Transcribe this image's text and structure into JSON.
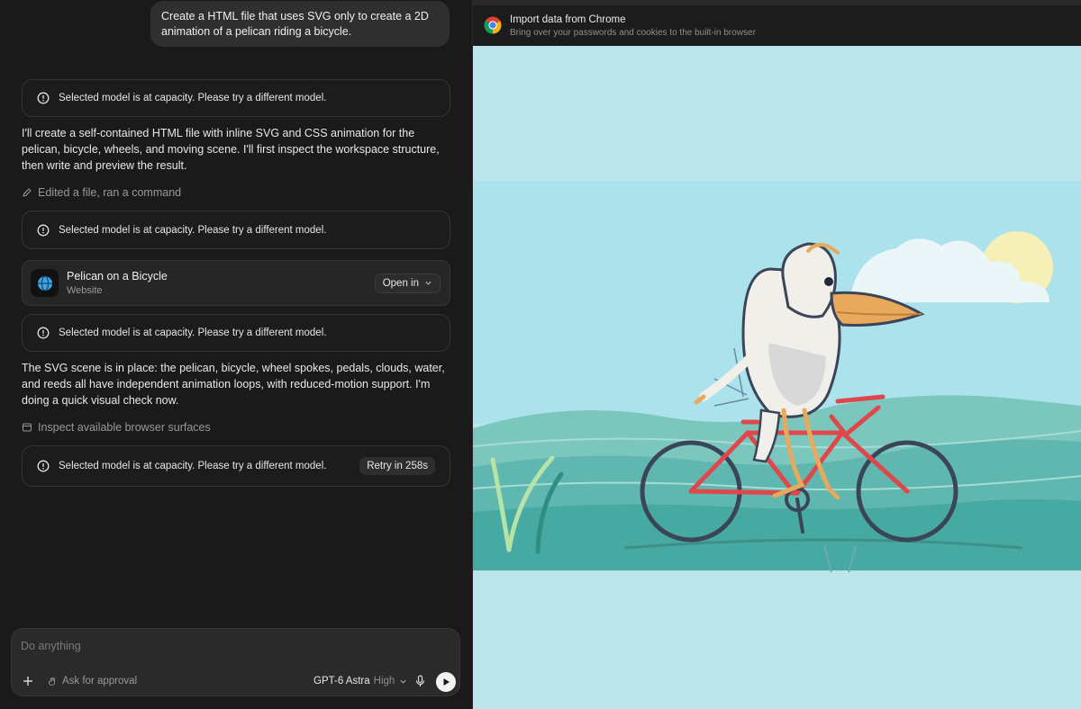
{
  "chat": {
    "user_prompt": "Create a HTML file that uses SVG only to create a 2D animation of a pelican riding a bicycle.",
    "alerts": [
      "Selected model is at capacity. Please try a different model.",
      "Selected model is at capacity. Please try a different model.",
      "Selected model is at capacity. Please try a different model.",
      "Selected model is at capacity. Please try a different model."
    ],
    "retry_label": "Retry in 258s",
    "paragraph1": "I'll create a self-contained HTML file with inline SVG and CSS animation for the pelican, bicycle, wheels, and moving scene. I'll first inspect the workspace structure, then write and preview the result.",
    "action1": "Edited a file, ran a command",
    "card": {
      "title": "Pelican on a Bicycle",
      "subtitle": "Website",
      "open_label": "Open in"
    },
    "paragraph2": "The SVG scene is in place: the pelican, bicycle, wheel spokes, pedals, clouds, water, and reeds all have independent animation loops, with reduced-motion support. I'm doing a quick visual check now.",
    "action2": "Inspect available browser surfaces"
  },
  "composer": {
    "placeholder": "Do anything",
    "approval_label": "Ask for approval",
    "model_name": "GPT-6 Astra",
    "effort": "High"
  },
  "browser": {
    "import_title": "Import data from Chrome",
    "import_subtitle": "Bring over your passwords and cookies to the built-in browser"
  },
  "colors": {
    "sky": "#bde6ec",
    "water": "#5fb7b0",
    "bike_frame": "#e0474a",
    "sun": "#f4f0b8",
    "beak": "#e8a95c"
  }
}
